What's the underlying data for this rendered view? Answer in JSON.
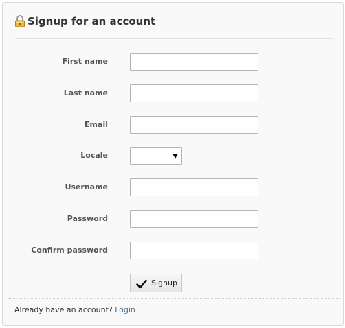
{
  "header": {
    "title": "Signup for an account",
    "icon": "lock-icon"
  },
  "form": {
    "fields": [
      {
        "key": "first_name",
        "label": "First name",
        "value": ""
      },
      {
        "key": "last_name",
        "label": "Last name",
        "value": ""
      },
      {
        "key": "email",
        "label": "Email",
        "value": ""
      },
      {
        "key": "locale",
        "label": "Locale",
        "value": ""
      },
      {
        "key": "username",
        "label": "Username",
        "value": ""
      },
      {
        "key": "password",
        "label": "Password",
        "value": ""
      },
      {
        "key": "confirm_password",
        "label": "Confirm password",
        "value": ""
      }
    ],
    "submit_label": "Signup",
    "submit_icon": "checkmark-icon"
  },
  "footer": {
    "prompt": "Already have an account?",
    "login_link": "Login"
  }
}
